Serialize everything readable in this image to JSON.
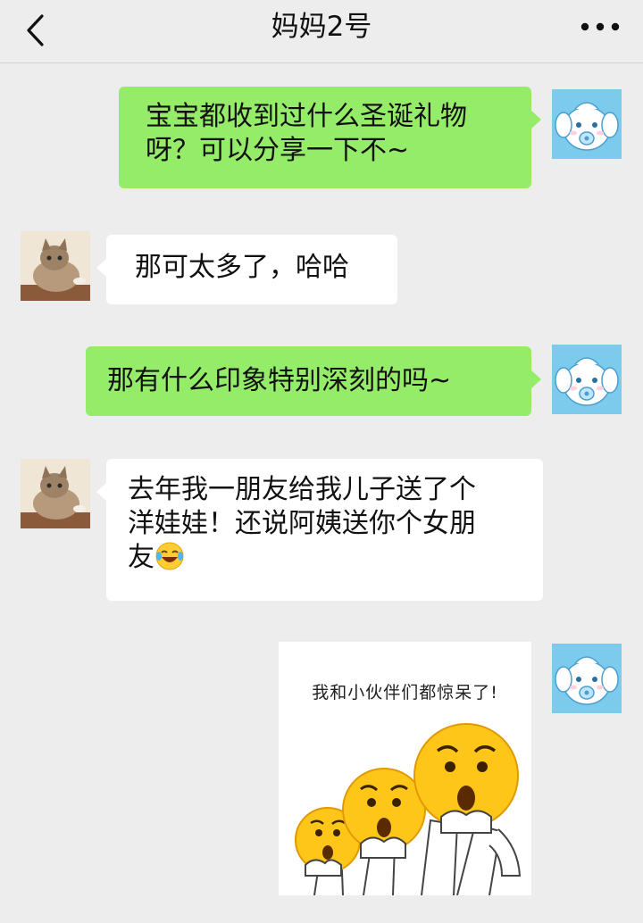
{
  "header": {
    "title": "妈妈2号",
    "back_icon": "chevron-left-icon",
    "more_icon": "more-dots-icon"
  },
  "messages": [
    {
      "sender": "me",
      "text_lines": [
        "宝宝都收到过什么圣诞礼物",
        "呀？可以分享一下不~"
      ]
    },
    {
      "sender": "them",
      "text_lines": [
        "那可太多了，哈哈"
      ]
    },
    {
      "sender": "me",
      "text_lines": [
        "那有什么印象特别深刻的吗~"
      ]
    },
    {
      "sender": "them",
      "text_lines": [
        "去年我一朋友给我儿子送了个",
        "洋娃娃！还说阿姨送你个女朋",
        "友"
      ],
      "inline_emoji": "laugh-cry-emoji-icon"
    },
    {
      "sender": "me",
      "sticker": {
        "caption": "我和小伙伴们都惊呆了!",
        "icon": "shocked-faces-sticker"
      }
    }
  ],
  "avatars": {
    "me": "cartoon-lamb-avatar",
    "them": "kitten-photo-avatar"
  },
  "colors": {
    "background": "#ededed",
    "my_bubble": "#95ec69",
    "their_bubble": "#ffffff"
  }
}
